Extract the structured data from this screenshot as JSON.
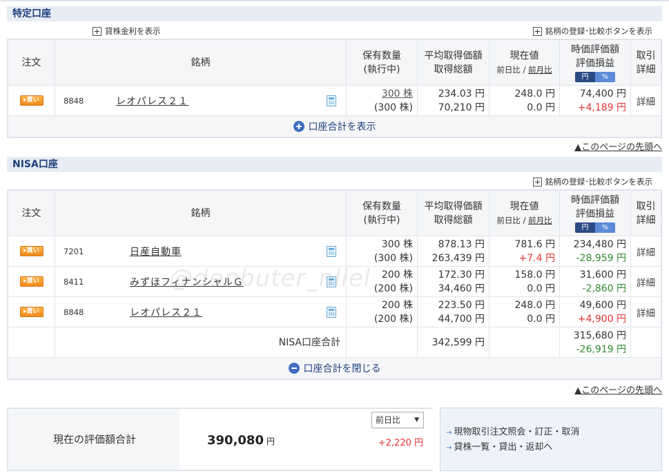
{
  "tokutei": {
    "title": "特定口座",
    "lend_link": "貸株金利を表示",
    "compare_link": "銘柄の登録･比較ボタンを表示",
    "headers": {
      "order": "注文",
      "name": "銘柄",
      "qty1": "保有数量",
      "qty2": "(執行中)",
      "avg1": "平均取得価額",
      "avg2": "取得総額",
      "cur1": "現在値",
      "cur_prev_day": "前日比",
      "cur_sep": " / ",
      "cur_prev_month": "前月比",
      "val1": "時価評価額",
      "val2": "評価損益",
      "toggle_yen": "円",
      "toggle_pct": "%",
      "det1": "取引",
      "det2": "詳細"
    },
    "rows": [
      {
        "badge": "▸買い",
        "code": "8848",
        "name": "レオパレス２１",
        "qty": "300 株",
        "qty_pending": "(300 株)",
        "avg_price": "234.03 円",
        "total_cost": "70,210 円",
        "price": "248.0 円",
        "change": "0.0 円",
        "market_value": "74,400 円",
        "pnl": "+4,189 円",
        "detail": "詳細"
      }
    ],
    "footer": "口座合計を表示",
    "page_top": "▲このページの先頭へ"
  },
  "nisa": {
    "title": "NISA口座",
    "compare_link": "銘柄の登録･比較ボタンを表示",
    "rows": [
      {
        "badge": "▸買い",
        "code": "7201",
        "name": "日産自動車",
        "qty": "300 株",
        "qty_pending": "(300 株)",
        "avg_price": "878.13 円",
        "total_cost": "263,439 円",
        "price": "781.6 円",
        "change": "+7.4 円",
        "market_value": "234,480 円",
        "pnl": "-28,959 円",
        "detail": "詳細"
      },
      {
        "badge": "▸買い",
        "code": "8411",
        "name": "みずほフィナンシャルＧ",
        "qty": "200 株",
        "qty_pending": "(200 株)",
        "avg_price": "172.30 円",
        "total_cost": "34,460 円",
        "price": "158.0 円",
        "change": "0.0 円",
        "market_value": "31,600 円",
        "pnl": "-2,860 円",
        "detail": "詳細"
      },
      {
        "badge": "▸買い",
        "code": "8848",
        "name": "レオパレス２１",
        "qty": "200 株",
        "qty_pending": "(200 株)",
        "avg_price": "223.50 円",
        "total_cost": "44,700 円",
        "price": "248.0 円",
        "change": "0.0 円",
        "market_value": "49,600 円",
        "pnl": "+4,900 円",
        "detail": "詳細"
      }
    ],
    "total": {
      "label": "NISA口座合計",
      "total_cost": "342,599 円",
      "market_value": "315,680 円",
      "pnl": "-26,919 円"
    },
    "footer": "口座合計を閉じる",
    "page_top": "▲このページの先頭へ"
  },
  "summary": {
    "label": "現在の評価額合計",
    "value": "390,080",
    "yen": "円",
    "select_value": "前日比",
    "diff": "+2,220 円"
  },
  "links": [
    "現物取引注文照会・訂正・取消",
    "貸株一覧・貸出・返却へ"
  ],
  "watermark": "@denbuter_nliel",
  "colors": {
    "plus": "#e53333",
    "minus": "#2e8b2e",
    "header_text": "#1f3f7a",
    "section_bg": "#e7ecf5"
  }
}
